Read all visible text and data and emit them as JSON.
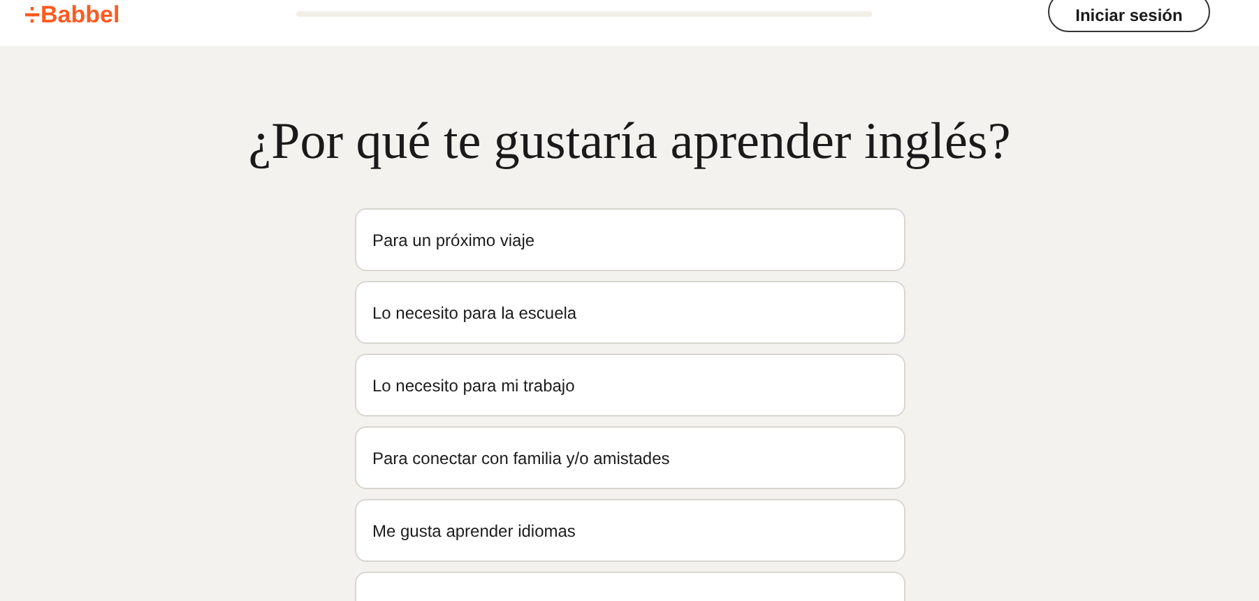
{
  "header": {
    "logo": "Babbel",
    "progress": {
      "level": 0
    },
    "login_button": "Iniciar sesión"
  },
  "question": "¿Por qué te gustaría aprender inglés?",
  "options": [
    {
      "label": "Para un próximo viaje"
    },
    {
      "label": "Lo necesito para la escuela"
    },
    {
      "label": "Lo necesito para mi trabajo"
    },
    {
      "label": "Para conectar con familia y/o amistades"
    },
    {
      "label": "Me gusta aprender idiomas"
    }
  ]
}
